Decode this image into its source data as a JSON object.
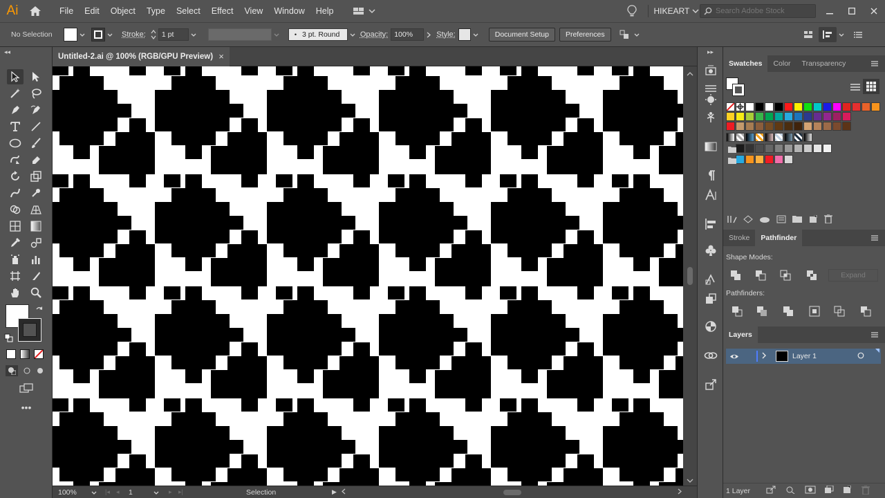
{
  "app": {
    "logo": "Ai"
  },
  "menu": {
    "items": [
      "File",
      "Edit",
      "Object",
      "Type",
      "Select",
      "Effect",
      "View",
      "Window",
      "Help"
    ]
  },
  "workspace": {
    "name": "HIKEART"
  },
  "search": {
    "placeholder": "Search Adobe Stock"
  },
  "control_bar": {
    "selection_state": "No Selection",
    "stroke_label": "Stroke:",
    "stroke_weight": "1 pt",
    "brush": "3 pt. Round",
    "opacity_label": "Opacity:",
    "opacity_value": "100%",
    "style_label": "Style:",
    "document_setup": "Document Setup",
    "preferences": "Preferences"
  },
  "document": {
    "tab_title": "Untitled-2.ai @ 100% (RGB/GPU Preview)",
    "close_glyph": "×"
  },
  "status_bar": {
    "zoom": "100%",
    "artboard": "1",
    "tool": "Selection"
  },
  "panels": {
    "swatches_group": {
      "tabs": [
        "Swatches",
        "Color",
        "Transparency"
      ]
    },
    "pathfinder_group": {
      "tabs": [
        "Stroke",
        "Pathfinder"
      ],
      "shape_modes_label": "Shape Modes:",
      "pathfinders_label": "Pathfinders:",
      "expand_label": "Expand"
    },
    "layers_group": {
      "tabs": [
        "Layers"
      ],
      "layer_name": "Layer 1",
      "footer_count": "1 Layer"
    }
  },
  "colors": {
    "ui_panel": "#535353",
    "ui_dark": "#454545",
    "selection_blue": "#4b6581",
    "pattern_black": "#000000",
    "pattern_white": "#ffffff",
    "swatches_row1": [
      "#000000",
      "#ffffff",
      "#000000",
      "#ff1a1a",
      "#ffef00",
      "#11dd11",
      "#00c8c8",
      "#1b1be6",
      "#ff00ff",
      "#e0241f",
      "#e42f2f",
      "#e8622a",
      "#f7941d"
    ],
    "swatches_row2": [
      "#fdd023",
      "#f6eb15",
      "#aacd37",
      "#39b54a",
      "#00a651",
      "#00a99d",
      "#27aae1",
      "#1c75bc",
      "#2b3990",
      "#662d91",
      "#92278f",
      "#9e1f63",
      "#d91c5c"
    ],
    "swatches_row3": [
      "#ed1c24",
      "#c49a6c",
      "#a67c52",
      "#8b5e3c",
      "#754c24",
      "#603913",
      "#4b2d0f",
      "#40230b",
      "#d4a373",
      "#b5835a",
      "#9c6a48",
      "#7b4a2e",
      "#5c3317"
    ],
    "swatches_row4": [
      "#1a1a1a",
      "#333333",
      "#4d4d4d",
      "#666666",
      "#808080",
      "#999999",
      "#b3b3b3",
      "#cccccc",
      "#e6e6e6",
      "#f2f2f2"
    ],
    "swatches_row5": [
      "#27aae1",
      "#f7941d",
      "#fbb040",
      "#ed1c24",
      "#f06eaa",
      "#d8d8d8"
    ]
  }
}
